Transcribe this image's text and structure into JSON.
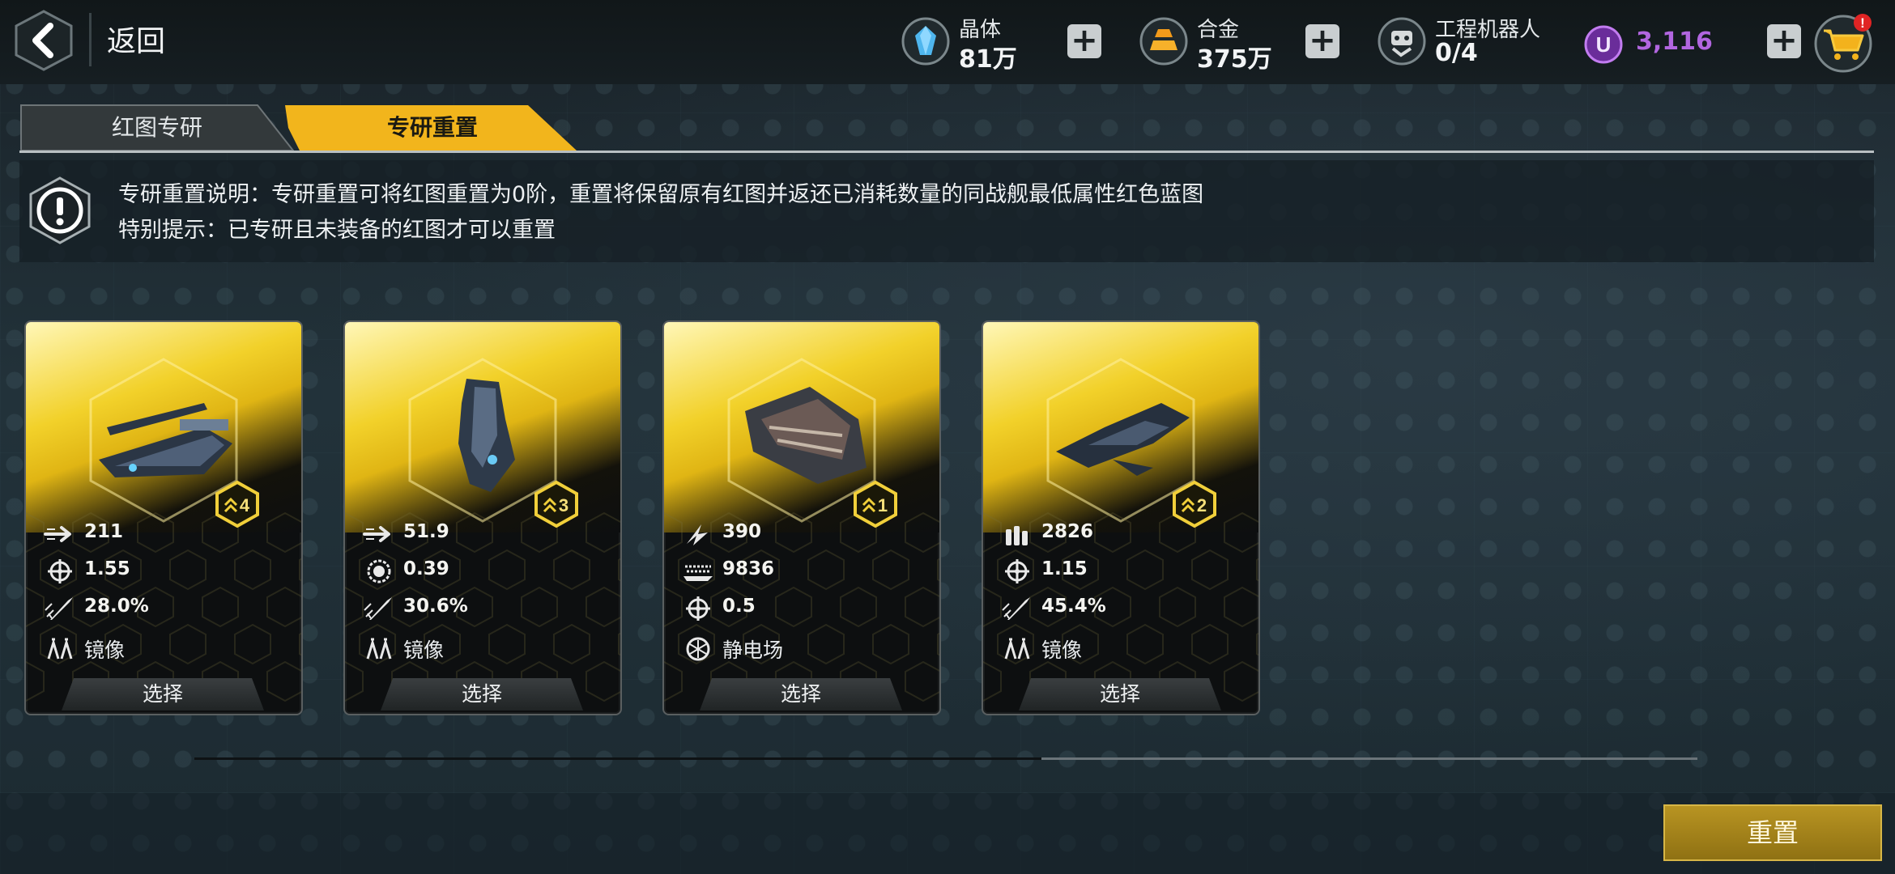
{
  "header": {
    "back_label": "返回",
    "resources": [
      {
        "name": "晶体",
        "value": "81万",
        "icon": "crystal-icon"
      },
      {
        "name": "合金",
        "value": "375万",
        "icon": "alloy-icon"
      },
      {
        "name": "工程机器人",
        "value": "0/4",
        "icon": "robot-icon"
      }
    ],
    "credits": {
      "icon_letter": "U",
      "value": "3,116"
    },
    "cart_badge": "!"
  },
  "tabs": [
    {
      "label": "红图专研",
      "active": false
    },
    {
      "label": "专研重置",
      "active": true
    }
  ],
  "info": {
    "line1": "专研重置说明：专研重置可将红图重置为0阶，重置将保留原有红图并返还已消耗数量的同战舰最低属性红色蓝图",
    "line2": "特别提示：已专研且未装备的红图才可以重置"
  },
  "cards": [
    {
      "rank": "4",
      "stats": [
        {
          "icon": "speed-arrow-icon",
          "value": "211"
        },
        {
          "icon": "crosshair-icon",
          "value": "1.55"
        },
        {
          "icon": "missile-icon",
          "value": "28.0%"
        }
      ],
      "ability": {
        "icon": "mirror-icon",
        "label": "镜像"
      },
      "button": "选择"
    },
    {
      "rank": "3",
      "stats": [
        {
          "icon": "speed-arrow-icon",
          "value": "51.9"
        },
        {
          "icon": "shield-ring-icon",
          "value": "0.39"
        },
        {
          "icon": "missile-icon",
          "value": "30.6%"
        }
      ],
      "ability": {
        "icon": "mirror-icon",
        "label": "镜像"
      },
      "button": "选择"
    },
    {
      "rank": "1",
      "stats": [
        {
          "icon": "lightning-icon",
          "value": "390"
        },
        {
          "icon": "hull-icon",
          "value": "9836"
        },
        {
          "icon": "crosshair-icon",
          "value": "0.5"
        }
      ],
      "ability": {
        "icon": "static-field-icon",
        "label": "静电场"
      },
      "button": "选择"
    },
    {
      "rank": "2",
      "stats": [
        {
          "icon": "ammo-icon",
          "value": "2826"
        },
        {
          "icon": "crosshair-icon",
          "value": "1.15"
        },
        {
          "icon": "missile-icon",
          "value": "45.4%"
        }
      ],
      "ability": {
        "icon": "mirror-icon",
        "label": "镜像"
      },
      "button": "选择"
    }
  ],
  "reset_button": "重置",
  "colors": {
    "accent": "#f2c21a",
    "credit": "#b266e0",
    "reset": "#a98a1d"
  }
}
